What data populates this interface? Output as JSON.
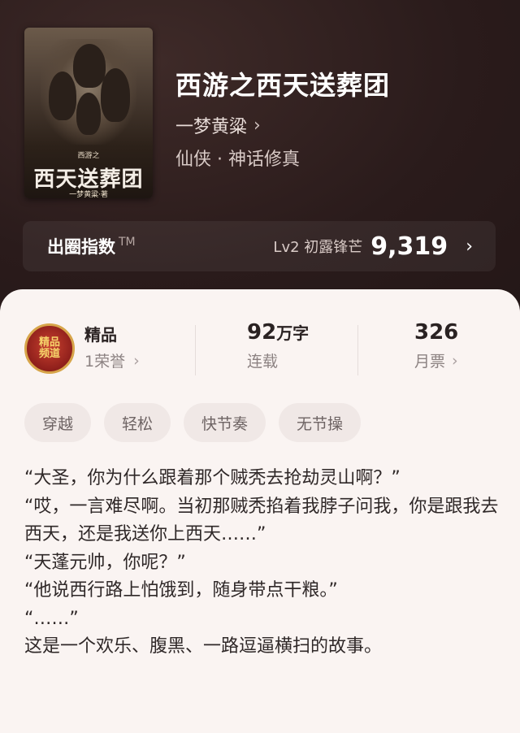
{
  "book": {
    "title": "西游之西天送葬团",
    "author": "一梦黄粱",
    "genre": "仙侠 · 神话修真",
    "cover": {
      "small_text": "西游之",
      "title": "西天送葬团",
      "author": "一梦黄粱·著"
    }
  },
  "index": {
    "label": "出圈指数",
    "tm": "TM",
    "level": "Lv2 初露锋芒",
    "value": "9,319"
  },
  "stats": {
    "badge_text": [
      "精品",
      "频道"
    ],
    "quality_label": "精品",
    "honor": "1荣誉",
    "words_num": "92",
    "words_unit": "万字",
    "status": "连载",
    "tickets_num": "326",
    "tickets_label": "月票"
  },
  "tags": [
    "穿越",
    "轻松",
    "快节奏",
    "无节操"
  ],
  "description": [
    "“大圣，你为什么跟着那个贼秃去抢劫灵山啊？”",
    "“哎，一言难尽啊。当初那贼秃掐着我脖子问我，你是跟我去西天，还是我送你上西天……”",
    "“天蓬元帅，你呢？”",
    "“他说西行路上怕饿到，随身带点干粮。”",
    "“……”",
    "这是一个欢乐、腹黑、一路逗逼横扫的故事。"
  ],
  "colors": {
    "header_bg": "#2a1c1c",
    "card_bg": "#faf4f2",
    "tag_bg": "#f0e8e6",
    "badge_red": "#8e1f1b",
    "badge_gold": "#d7a54a"
  },
  "icons": {
    "chevron": "chevron-right-icon"
  }
}
